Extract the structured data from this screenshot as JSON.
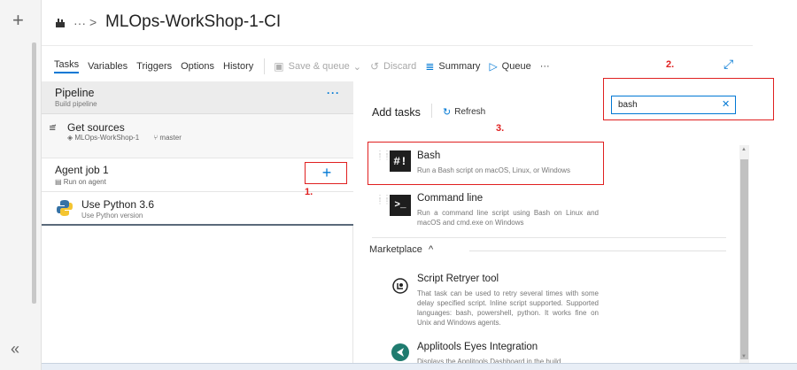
{
  "breadcrumb": {
    "ellipsis": "···",
    "separator": ">",
    "title": "MLOps-WorkShop-1-CI"
  },
  "toolbar": {
    "tabs": [
      {
        "label": "Tasks"
      },
      {
        "label": "Variables"
      },
      {
        "label": "Triggers"
      },
      {
        "label": "Options"
      },
      {
        "label": "History"
      }
    ],
    "save_queue": "Save & queue",
    "discard": "Discard",
    "summary": "Summary",
    "queue": "Queue",
    "more": "···"
  },
  "pipeline": {
    "title": "Pipeline",
    "subtitle": "Build pipeline",
    "more": "···",
    "get_sources": {
      "title": "Get sources",
      "repo": "MLOps-WorkShop-1",
      "branch": "master"
    },
    "agent_job": {
      "title": "Agent job 1",
      "subtitle": "Run on agent",
      "add": "+"
    },
    "python_task": {
      "title": "Use Python 3.6",
      "subtitle": "Use Python version"
    }
  },
  "add_tasks": {
    "title": "Add tasks",
    "refresh": "Refresh",
    "search": {
      "value": "bash",
      "clear": "✕"
    },
    "tasks": [
      {
        "name": "Bash",
        "icon": "#!",
        "description": "Run a Bash script on macOS, Linux, or Windows"
      },
      {
        "name": "Command line",
        "icon": ">_",
        "description": "Run a command line script using Bash on Linux and macOS and cmd.exe on Windows"
      }
    ],
    "marketplace": {
      "label": "Marketplace",
      "toggle": "^"
    },
    "marketplace_items": [
      {
        "name": "Script Retryer tool",
        "description": "That task can be used to retry several times with some delay specified script. Inline script supported. Supported languages: bash, powershell, python. It works fine on Unix and Windows agents."
      },
      {
        "name": "Applitools Eyes Integration",
        "description": "Displays the Applitools Dashboard in the build"
      }
    ]
  },
  "annotations": {
    "one": "1.",
    "two": "2.",
    "three": "3."
  },
  "colors": {
    "accent": "#0078d4",
    "annotation": "#e02020"
  }
}
